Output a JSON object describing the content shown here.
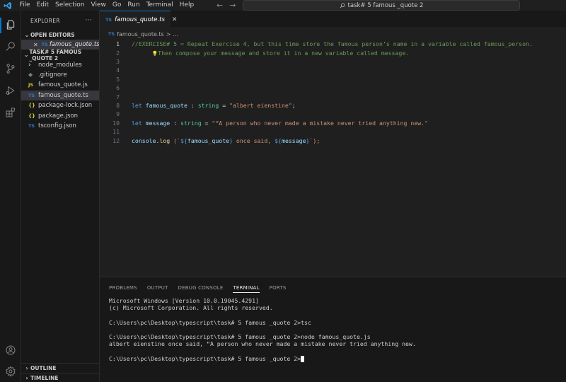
{
  "menu": [
    "File",
    "Edit",
    "Selection",
    "View",
    "Go",
    "Run",
    "Terminal",
    "Help"
  ],
  "command_center": {
    "text": "task# 5 famous _quote 2"
  },
  "sidebar": {
    "title": "EXPLORER",
    "more": "···",
    "open_editors_label": "OPEN EDITORS",
    "open_editor": {
      "close": "✕",
      "icon": "TS",
      "name": "famous_quote.ts"
    },
    "project_label": "TASK# 5 FAMOUS _QUOTE 2",
    "files": [
      {
        "icon": "›",
        "name": "node_modules"
      },
      {
        "icon": "◆",
        "name": ".gitignore"
      },
      {
        "icon": "JS",
        "name": "famous_quote.js"
      },
      {
        "icon": "TS",
        "name": "famous_quote.ts"
      },
      {
        "icon": "{}",
        "name": "package-lock.json"
      },
      {
        "icon": "{}",
        "name": "package.json"
      },
      {
        "icon": "TS",
        "name": "tsconfig.json"
      }
    ],
    "outline_label": "OUTLINE",
    "timeline_label": "TIMELINE"
  },
  "tab": {
    "icon": "TS",
    "name": "famous_quote.ts",
    "close": "✕"
  },
  "breadcrumb": {
    "icon": "TS",
    "file": "famous_quote.ts",
    "sep": ">",
    "rest": "..."
  },
  "editor": {
    "line_numbers": [
      "1",
      "2",
      "3",
      "4",
      "5",
      "6",
      "7",
      "8",
      "9",
      "10",
      "11",
      "12"
    ],
    "line1": "//EXERCISE# 5 = Repeat Exercise 4, but this time store the famous person’s name in a variable called famous_person.",
    "line2_bulb": "💡",
    "line2": "Then compose your message and store it in a new variable called message.",
    "line8": {
      "kw": "let",
      "var": "famous_quote",
      "colon": " : ",
      "type": "string",
      "eq": " = ",
      "str": "\"albert eienstine\"",
      "end": ";"
    },
    "line10": {
      "kw": "let",
      "var": "message",
      "colon": " : ",
      "type": "string",
      "eq": " = ",
      "str": "\"“A person who never made a mistake never tried anything new.\""
    },
    "line12": {
      "obj": "console",
      "dot": ".",
      "fn": "log",
      "open": " (`",
      "i1o": "${",
      "i1v": "famous_quote",
      "i1c": "}",
      "mid": " once said, ",
      "i2o": "${",
      "i2v": "message",
      "i2c": "}",
      "close": "`);"
    }
  },
  "panel": {
    "tabs": [
      "PROBLEMS",
      "OUTPUT",
      "DEBUG CONSOLE",
      "TERMINAL",
      "PORTS"
    ],
    "terminal_lines": [
      "Microsoft Windows [Version 10.0.19045.4291]",
      "(c) Microsoft Corporation. All rights reserved.",
      "",
      "C:\\Users\\pc\\Desktop\\typescript\\task# 5 famous _quote 2>tsc",
      "",
      "C:\\Users\\pc\\Desktop\\typescript\\task# 5 famous _quote 2>node famous_quote.js",
      "albert eienstine once said, “A person who never made a mistake never tried anything new.",
      ""
    ],
    "prompt": "C:\\Users\\pc\\Desktop\\typescript\\task# 5 famous _quote 2>"
  }
}
